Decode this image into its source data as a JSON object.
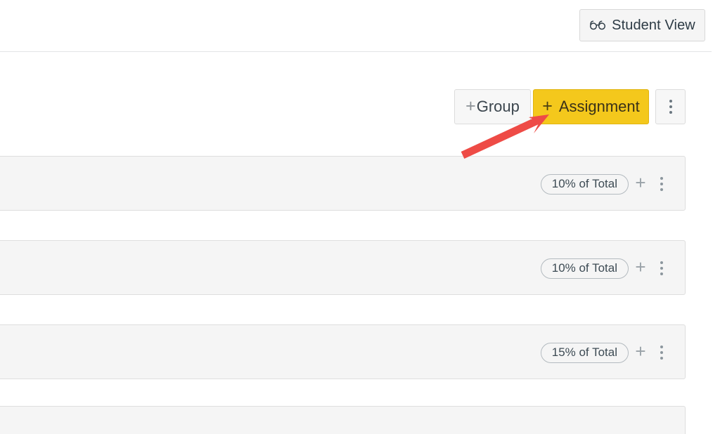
{
  "header": {
    "student_view_button": {
      "label": "Student View",
      "icon": "glasses-icon"
    }
  },
  "toolbar": {
    "add_group_button": {
      "plus": "+",
      "label": "Group"
    },
    "add_assignment_button": {
      "plus": "+",
      "label": "Assignment",
      "accent_color": "#f4c81c"
    },
    "more_options_button": {
      "icon": "kebab-menu-icon"
    }
  },
  "annotation": {
    "arrow_color": "#ee4b46",
    "points_to": "add_assignment_button"
  },
  "assignment_groups": [
    {
      "weight_label": "10% of Total",
      "add_label": "+",
      "menu_icon": "kebab-menu-icon"
    },
    {
      "weight_label": "10% of Total",
      "add_label": "+",
      "menu_icon": "kebab-menu-icon"
    },
    {
      "weight_label": "15% of Total",
      "add_label": "+",
      "menu_icon": "kebab-menu-icon"
    }
  ],
  "partial_group_row": {
    "visible": true
  }
}
